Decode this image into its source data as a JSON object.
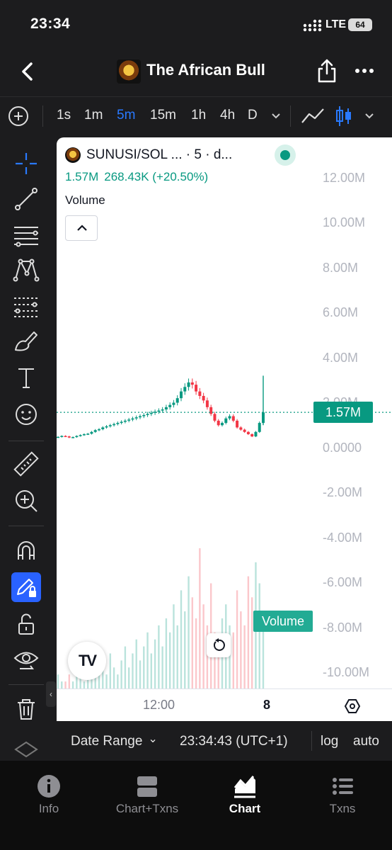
{
  "status_bar": {
    "time": "23:34",
    "network": "LTE",
    "battery": "64"
  },
  "header": {
    "title": "The African Bull"
  },
  "toolbar": {
    "intervals": [
      "1s",
      "1m",
      "5m",
      "15m",
      "1h",
      "4h",
      "D"
    ],
    "active_interval": "5m"
  },
  "left_tools": [
    "crosshair-icon",
    "trend-line-icon",
    "horizontal-lines-icon",
    "pattern-icon",
    "fib-levels-icon",
    "brush-icon",
    "text-icon",
    "emoji-icon",
    "ruler-icon",
    "zoom-in-icon",
    "magnet-icon",
    "lock-drawing-icon",
    "unlock-icon",
    "eye-icon",
    "trash-icon"
  ],
  "chart": {
    "symbol": "SUNUSI/SOL ...  · 5 · d...",
    "legend_price": "1.57M",
    "legend_change": "268.43K (+20.50%)",
    "volume_label": "Volume",
    "y_labels": [
      "12.00M",
      "10.00M",
      "8.00M",
      "6.00M",
      "4.00M",
      "2.00M",
      "0.0000",
      "-2.00M",
      "-4.00M",
      "-6.00M",
      "-8.00M",
      "-10.00M"
    ],
    "price_tag": "1.57M",
    "volume_tag": "Volume",
    "x_labels": [
      "12:00",
      "8"
    ],
    "logo_text": "TV",
    "colors": {
      "up": "#089981",
      "down": "#f23645",
      "last_price": "#089981"
    }
  },
  "chart_data": {
    "type": "candlestick",
    "title": "",
    "ylabel": "",
    "ylim": [
      -11000000,
      13000000
    ],
    "x_ticks": [
      "12:00",
      "8"
    ],
    "last_price": 1570000,
    "change": "268.43K (+20.50%)",
    "series": [
      {
        "name": "Price",
        "values": [
          480000,
          520000,
          500000,
          450000,
          470000,
          520000,
          560000,
          600000,
          620000,
          700000,
          780000,
          820000,
          900000,
          950000,
          1000000,
          1050000,
          1100000,
          1150000,
          1200000,
          1250000,
          1300000,
          1350000,
          1400000,
          1450000,
          1500000,
          1550000,
          1600000,
          1650000,
          1700000,
          1800000,
          1900000,
          2000000,
          2200000,
          2500000,
          2700000,
          2900000,
          2800000,
          2500000,
          2300000,
          2100000,
          1800000,
          1500000,
          1200000,
          1000000,
          1100000,
          1300000,
          1400000,
          1200000,
          900000,
          800000,
          700000,
          600000,
          500000,
          700000,
          1100000,
          1570000
        ]
      },
      {
        "name": "Volume",
        "values": [
          2,
          1,
          1,
          2,
          1,
          3,
          2,
          1,
          2,
          3,
          2,
          4,
          3,
          2,
          5,
          3,
          2,
          4,
          6,
          3,
          5,
          7,
          4,
          6,
          8,
          5,
          7,
          9,
          6,
          10,
          8,
          12,
          9,
          14,
          11,
          16,
          13,
          10,
          20,
          12,
          9,
          15,
          8,
          7,
          10,
          12,
          9,
          8,
          14,
          11,
          9,
          16,
          13,
          18,
          15,
          10
        ]
      }
    ]
  },
  "footer": {
    "date_range": "Date Range",
    "time": "23:34:43 (UTC+1)",
    "log": "log",
    "auto": "auto"
  },
  "tabs": [
    {
      "label": "Info",
      "icon": "info-icon"
    },
    {
      "label": "Chart+Txns",
      "icon": "chart-txns-icon"
    },
    {
      "label": "Chart",
      "icon": "chart-icon"
    },
    {
      "label": "Txns",
      "icon": "list-icon"
    }
  ],
  "active_tab": "Chart"
}
